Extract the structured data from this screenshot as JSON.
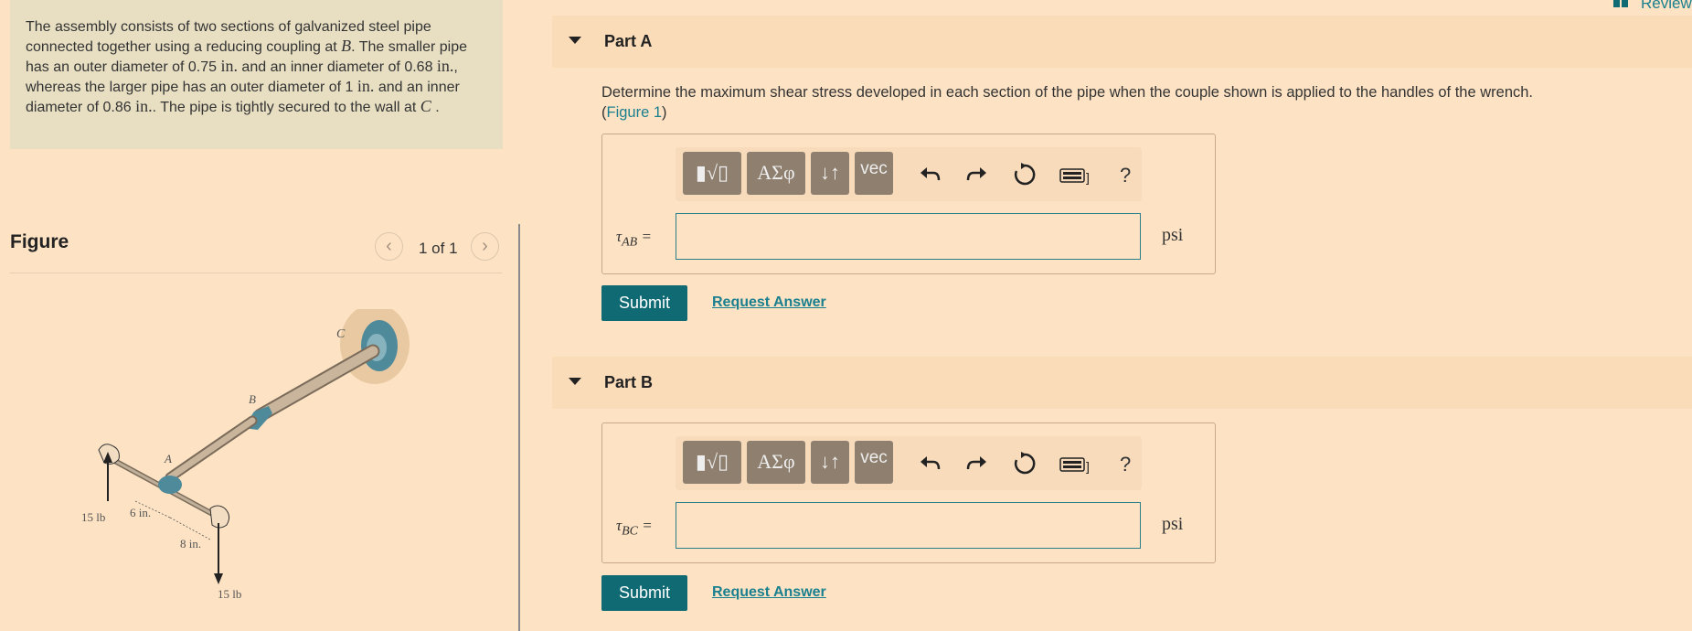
{
  "problem": {
    "s1": "The assembly consists of two sections of galvanized steel pipe connected together using a reducing coupling at ",
    "B": "B",
    "s2": ". The smaller pipe has an outer diameter of 0.75 ",
    "u1": "in.",
    "s3": " and an inner diameter of 0.68 ",
    "u2": "in.",
    "s4": ", whereas the larger pipe has an outer diameter of 1 ",
    "u3": "in.",
    "s5": " and an inner diameter of 0.86 ",
    "u4": "in.",
    "s6": ". The pipe is tightly secured to the wall at ",
    "C": "C",
    "s7": " ."
  },
  "figure": {
    "title": "Figure",
    "pager": "1 of 1",
    "prev_glyph": "‹",
    "next_glyph": "›",
    "labels": {
      "C": "C",
      "B": "B",
      "A": "A",
      "load_left": "15 lb",
      "load_bottom": "15 lb",
      "dim_6": "6 in.",
      "dim_8": "8 in."
    }
  },
  "header": {
    "review_label": "Review"
  },
  "parts": [
    {
      "title": "Part A",
      "question_text": "Determine the maximum shear stress developed in each section of the pipe when the couple shown is applied to the handles of the wrench.",
      "figure_link_open": "(",
      "figure_link": "Figure 1",
      "figure_link_close": ")",
      "var_symbol": "τ",
      "var_sub": "AB",
      "eq": " =",
      "units": "psi",
      "submit": "Submit",
      "request": "Request Answer"
    },
    {
      "title": "Part B",
      "var_symbol": "τ",
      "var_sub": "BC",
      "eq": " =",
      "units": "psi",
      "submit": "Submit",
      "request": "Request Answer"
    }
  ],
  "toolbar": {
    "template_glyph": "▮√▯",
    "greek": "ΑΣφ",
    "arrows": "↓↑",
    "vec": "vec",
    "help": "?"
  },
  "icons": {
    "undo": "undo-icon",
    "redo": "redo-icon",
    "reset": "reset-icon",
    "keyboard": "keyboard-icon"
  },
  "colors": {
    "background": "#fde3c4",
    "accent": "#0f6a73",
    "link": "#1a7f8e",
    "toolbar_button": "#8e7f6f"
  }
}
